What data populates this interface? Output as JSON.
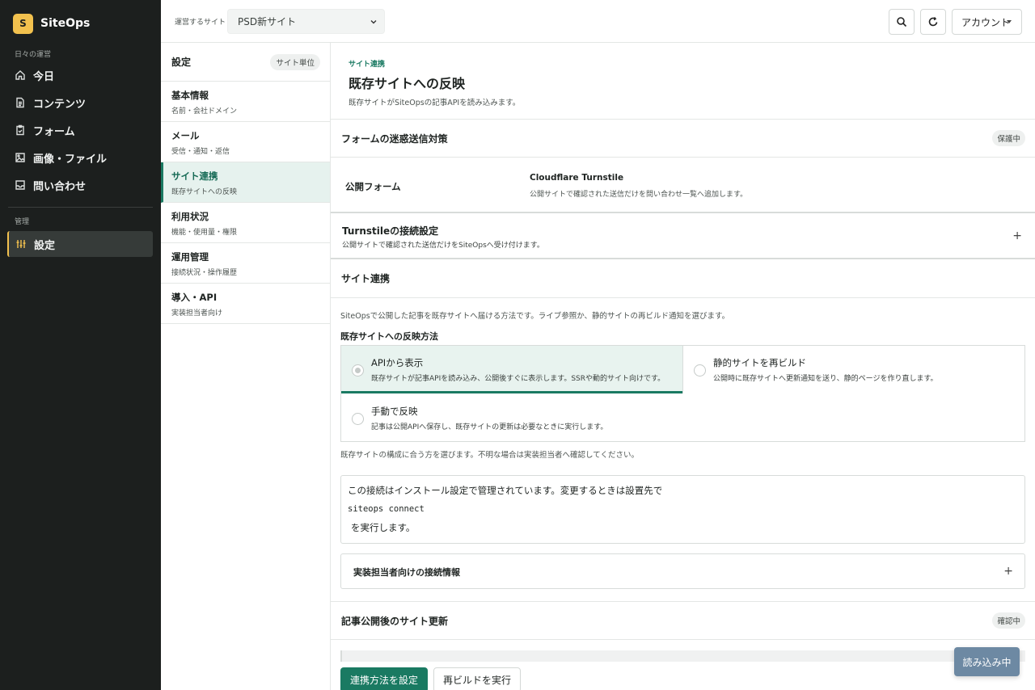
{
  "app": {
    "logo_letter": "S",
    "name": "SiteOps"
  },
  "sidebar": {
    "section_daily": "日々の運営",
    "items": [
      {
        "label": "今日",
        "icon": "home-icon"
      },
      {
        "label": "コンテンツ",
        "icon": "document-icon"
      },
      {
        "label": "フォーム",
        "icon": "clipboard-icon"
      },
      {
        "label": "画像・ファイル",
        "icon": "image-icon"
      },
      {
        "label": "問い合わせ",
        "icon": "inbox-icon"
      }
    ],
    "section_admin": "管理",
    "active_item": {
      "label": "設定",
      "icon": "sliders-icon"
    }
  },
  "topbar": {
    "site_label": "運営するサイト",
    "site_value": "PSD新サイト",
    "account_label": "アカウント"
  },
  "subnav": {
    "title": "設定",
    "scope_pill": "サイト単位",
    "items": [
      {
        "title": "基本情報",
        "sub": "名前・会社ドメイン"
      },
      {
        "title": "メール",
        "sub": "受信・通知・返信"
      },
      {
        "title": "サイト連携",
        "sub": "既存サイトへの反映"
      },
      {
        "title": "利用状況",
        "sub": "機能・使用量・権限"
      },
      {
        "title": "運用管理",
        "sub": "接続状況・操作履歴"
      },
      {
        "title": "導入・API",
        "sub": "実装担当者向け"
      }
    ]
  },
  "page": {
    "eyebrow": "サイト連携",
    "title": "既存サイトへの反映",
    "description": "既存サイトがSiteOpsの記事APIを読み込みます。"
  },
  "spam": {
    "title": "フォームの迷惑送信対策",
    "badge": "保護中",
    "row_label": "公開フォーム",
    "row_value": "Cloudflare Turnstile",
    "row_desc": "公開サイトで確認された送信だけを問い合わせ一覧へ追加します。"
  },
  "turnstile": {
    "title": "Turnstileの接続設定",
    "desc": "公開サイトで確認された送信だけをSiteOpsへ受け付けます。",
    "expand": "+"
  },
  "sync": {
    "title": "サイト連携",
    "desc": "SiteOpsで公開した記事を既存サイトへ届ける方法です。ライブ参照か、静的サイトの再ビルド通知を選びます。",
    "method_label": "既存サイトへの反映方法",
    "options": [
      {
        "title": "APIから表示",
        "desc": "既存サイトが記事APIを読み込み、公開後すぐに表示します。SSRや動的サイト向けです。",
        "selected": true
      },
      {
        "title": "静的サイトを再ビルド",
        "desc": "公開時に既存サイトへ更新通知を送り、静的ページを作り直します。",
        "selected": false
      },
      {
        "title": "手動で反映",
        "desc": "記事は公開APIへ保存し、既存サイトの更新は必要なときに実行します。",
        "selected": false
      }
    ],
    "hint": "既存サイトの構成に合う方を選びます。不明な場合は実装担当者へ確認してください。",
    "install_note": "この接続はインストール設定で管理されています。変更するときは設置先で",
    "command": "siteops connect",
    "install_tail": "を実行します。",
    "dev_info_title": "実装担当者向けの接続情報",
    "dev_info_expand": "+"
  },
  "publish": {
    "title": "記事公開後のサイト更新",
    "badge": "確認中",
    "primary_button": "連携方法を設定",
    "secondary_button": "再ビルドを実行"
  },
  "toast": {
    "label": "読み込み中"
  },
  "colors": {
    "sidebar_bg": "#1c1f1e",
    "brand_accent": "#f2c14e",
    "primary": "#1a7a62",
    "selected_bg": "#e8f3ef",
    "toast_bg": "#6d89a3"
  }
}
